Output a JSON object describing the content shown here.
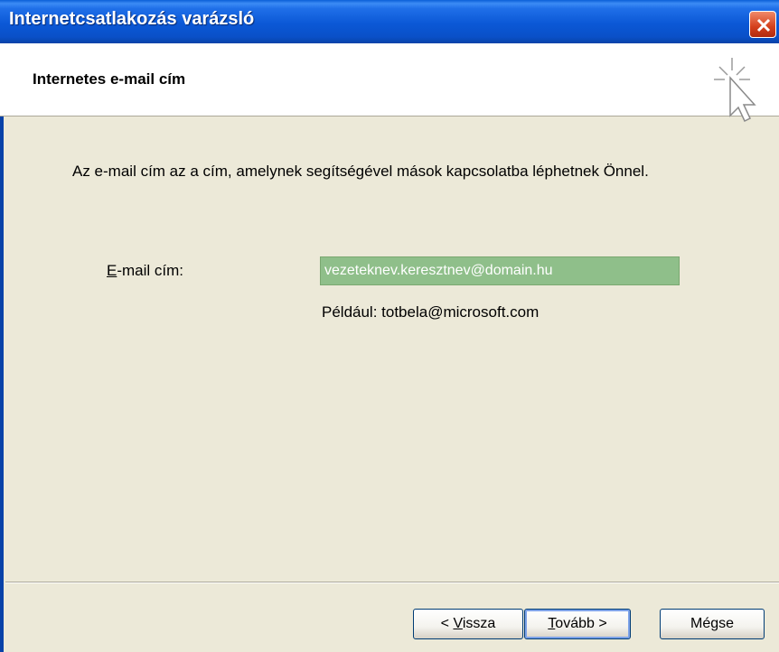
{
  "window": {
    "title": "Internetcsatlakozás varázsló"
  },
  "header": {
    "title": "Internetes e-mail cím",
    "icon": "wizard-cursor-icon"
  },
  "main": {
    "description": "Az e-mail cím az a cím, amelynek segítségével mások kapcsolatba léphetnek Önnel.",
    "email_label_accel": "E",
    "email_label_rest": "-mail cím:",
    "email_value": "vezeteknev.keresztnev@domain.hu",
    "example": "Például: totbela@microsoft.com"
  },
  "buttons": {
    "back_pre": "< ",
    "back_accel": "V",
    "back_rest": "issza",
    "next_accel": "T",
    "next_rest": "ovább >",
    "cancel": "Mégse"
  },
  "colors": {
    "titlebar": "#0B58D6",
    "input_bg": "#8FBF8A",
    "dialog_bg": "#ECE9D8"
  }
}
